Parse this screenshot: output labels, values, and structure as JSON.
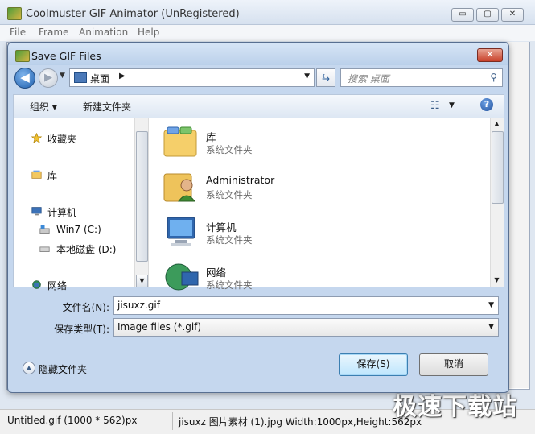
{
  "app": {
    "title": "Coolmuster GIF Animator (UnRegistered)",
    "controls": {
      "minimize": "▭",
      "maximize": "▢",
      "close": "✕"
    },
    "menu": [
      "File",
      "Frame",
      "Animation",
      "Help"
    ],
    "status_left": "Untitled.gif (1000 * 562)px",
    "status_right": "jisuxz 图片素材 (1).jpg Width:1000px,Height:562px",
    "watermark": "极速下载站"
  },
  "dialog": {
    "title": "Save GIF Files",
    "close_symbol": "✕",
    "address": {
      "location": "桌面"
    },
    "search_placeholder": "搜索 桌面",
    "toolbar": {
      "organize": "组织 ▾",
      "new_folder": "新建文件夹",
      "help": "?"
    },
    "nav_items": [
      {
        "label": "收藏夹",
        "icon": "star-icon"
      },
      {
        "label": "库",
        "icon": "library-icon"
      },
      {
        "label": "计算机",
        "icon": "computer-icon"
      },
      {
        "label": "Win7 (C:)",
        "icon": "drive-c-icon"
      },
      {
        "label": "本地磁盘 (D:)",
        "icon": "drive-d-icon"
      },
      {
        "label": "网络",
        "icon": "network-icon"
      }
    ],
    "files": [
      {
        "name": "库",
        "type": "系统文件夹",
        "icon": "library-folder-icon"
      },
      {
        "name": "Administrator",
        "type": "系统文件夹",
        "icon": "user-folder-icon"
      },
      {
        "name": "计算机",
        "type": "系统文件夹",
        "icon": "computer-icon"
      },
      {
        "name": "网络",
        "type": "系统文件夹",
        "icon": "network-icon"
      }
    ],
    "filename_label": "文件名(N):",
    "filename_value": "jisuxz.gif",
    "filetype_label": "保存类型(T):",
    "filetype_value": "Image files (*.gif)",
    "hide_folders": "隐藏文件夹",
    "save_button": "保存(S)",
    "cancel_button": "取消",
    "colors": {
      "accent": "#1e5fae",
      "dialog_frame": "#c5d7ee"
    }
  }
}
